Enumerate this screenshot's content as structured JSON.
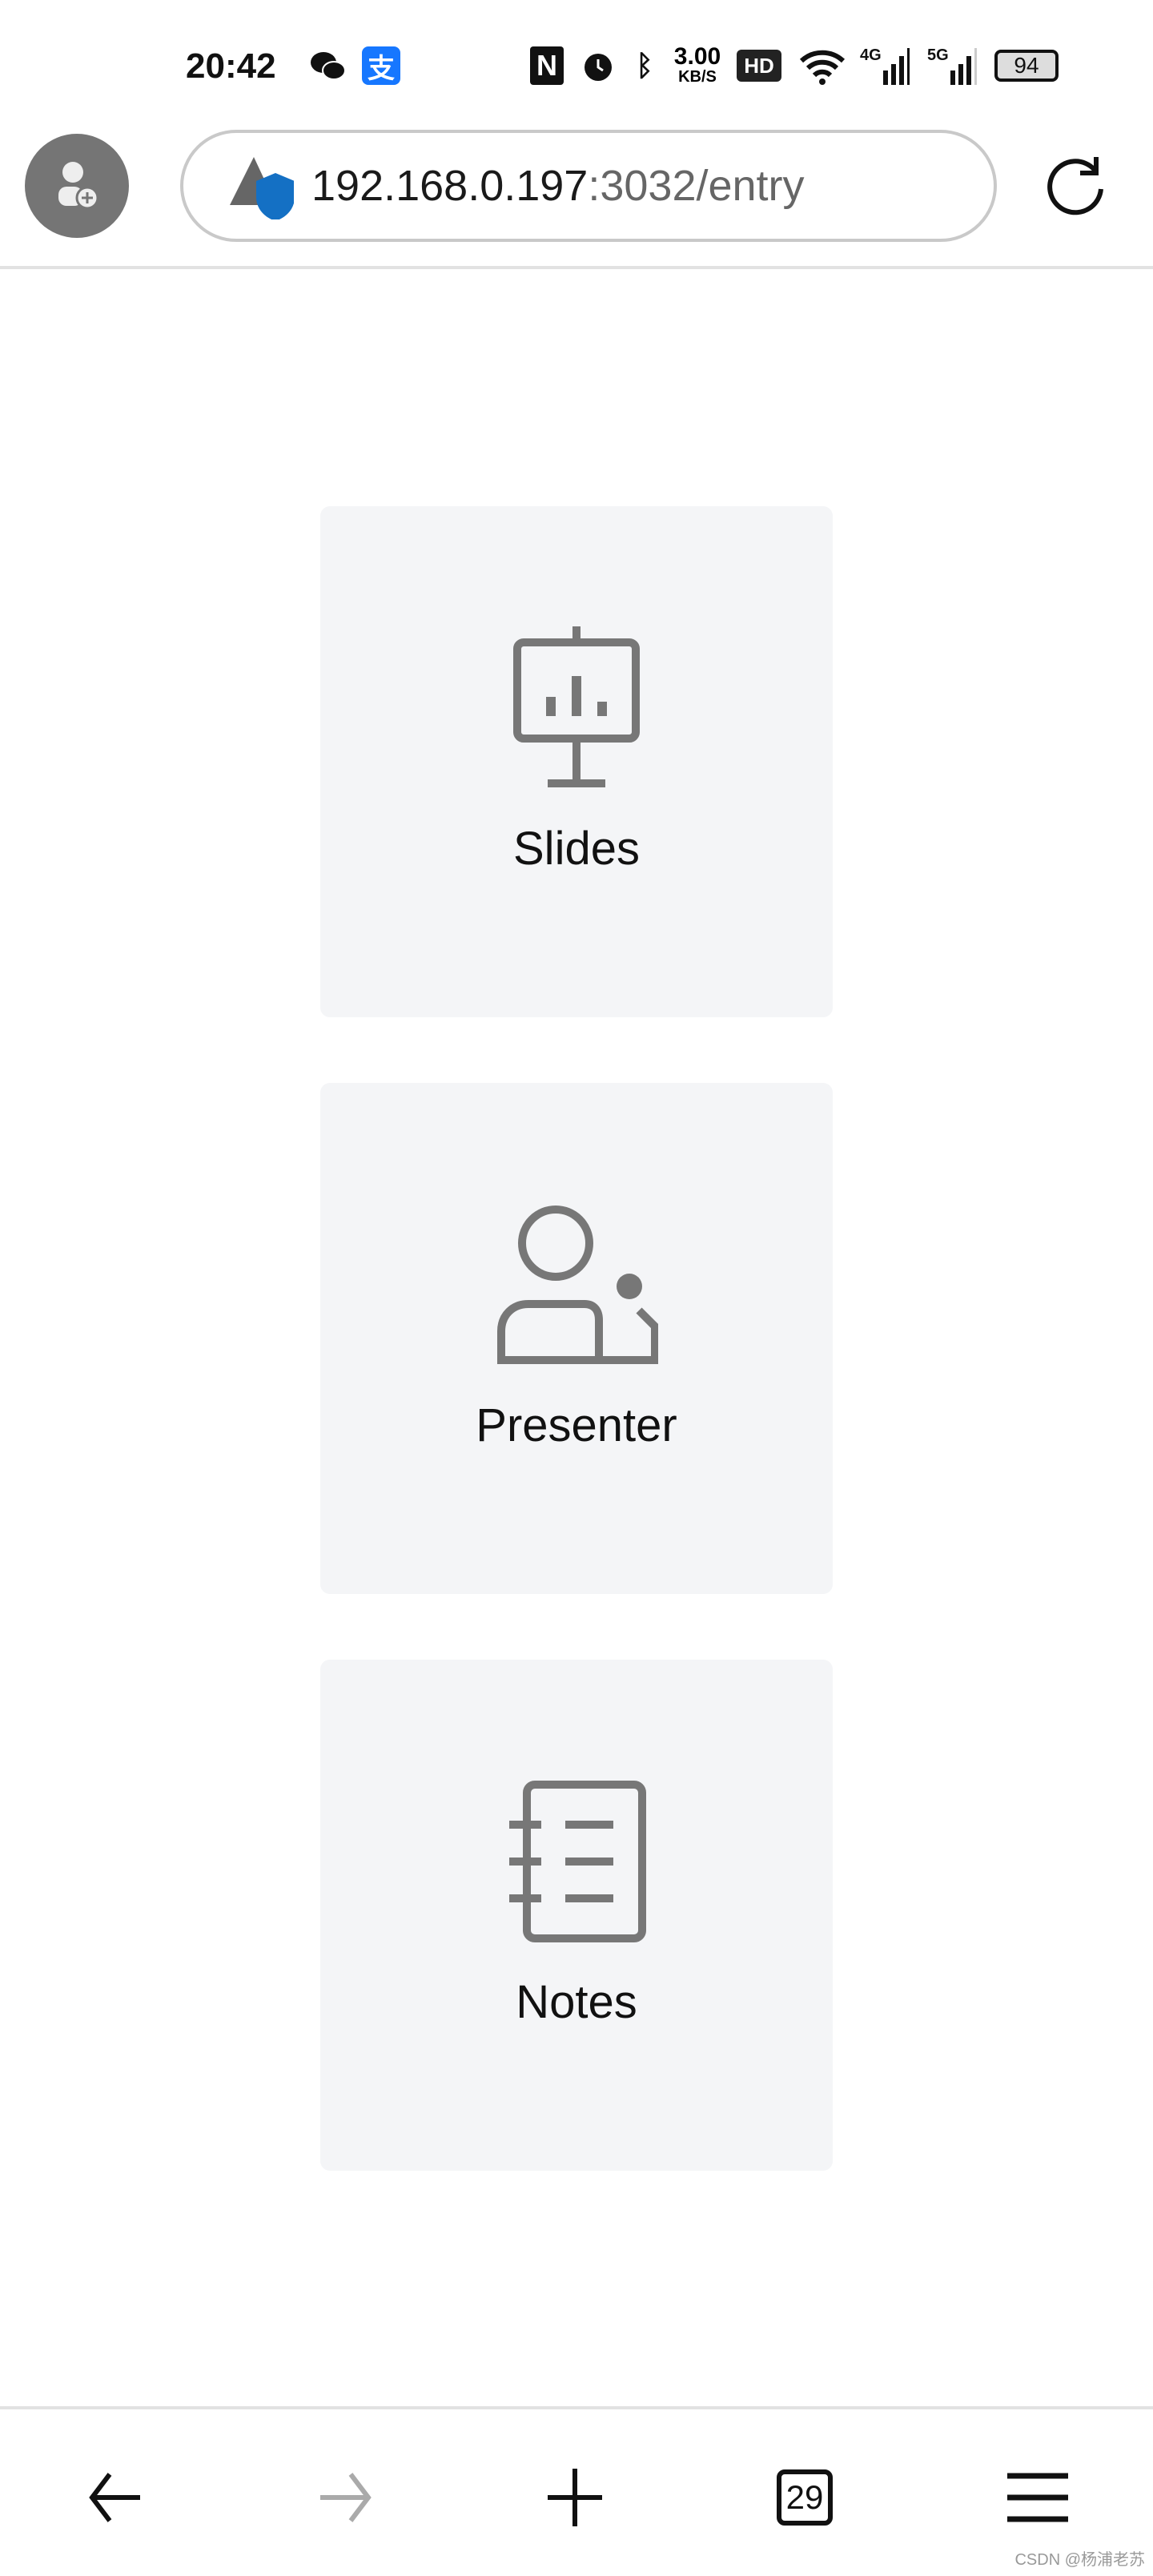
{
  "status_bar": {
    "time": "20:42",
    "net_speed": "3.00",
    "net_unit": "KB/S",
    "battery": "94",
    "signal1": "4G",
    "signal2": "5G",
    "hd": "HD"
  },
  "toolbar": {
    "url_host": "192.168.0.197",
    "url_rest": ":3032/entry"
  },
  "cards": [
    {
      "label": "Slides",
      "icon": "presentation-chart-icon"
    },
    {
      "label": "Presenter",
      "icon": "presenter-icon"
    },
    {
      "label": "Notes",
      "icon": "notebook-icon"
    }
  ],
  "bottom_nav": {
    "tab_count": "29"
  },
  "watermark": "CSDN @杨浦老苏",
  "colors": {
    "card_bg": "#f4f5f7",
    "icon_gray": "#777777",
    "shield_blue": "#1470c4",
    "alipay_blue": "#1677ff"
  }
}
